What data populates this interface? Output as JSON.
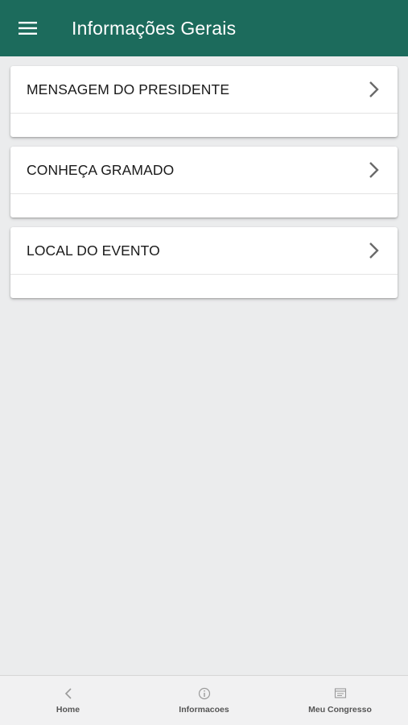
{
  "header": {
    "title": "Informações Gerais",
    "icon": "hamburger-menu-icon",
    "background_color": "#1c6b5c"
  },
  "cards": [
    {
      "label": "MENSAGEM DO PRESIDENTE",
      "icon": "chevron-right-icon"
    },
    {
      "label": "CONHEÇA GRAMADO",
      "icon": "chevron-right-icon"
    },
    {
      "label": "LOCAL DO EVENTO",
      "icon": "chevron-right-icon"
    }
  ],
  "bottom_nav": {
    "tabs": [
      {
        "label": "Home",
        "icon": "chevron-left-icon"
      },
      {
        "label": "Informacoes",
        "icon": "info-circle-icon"
      },
      {
        "label": "Meu Congresso",
        "icon": "congress-badge-icon"
      }
    ]
  }
}
